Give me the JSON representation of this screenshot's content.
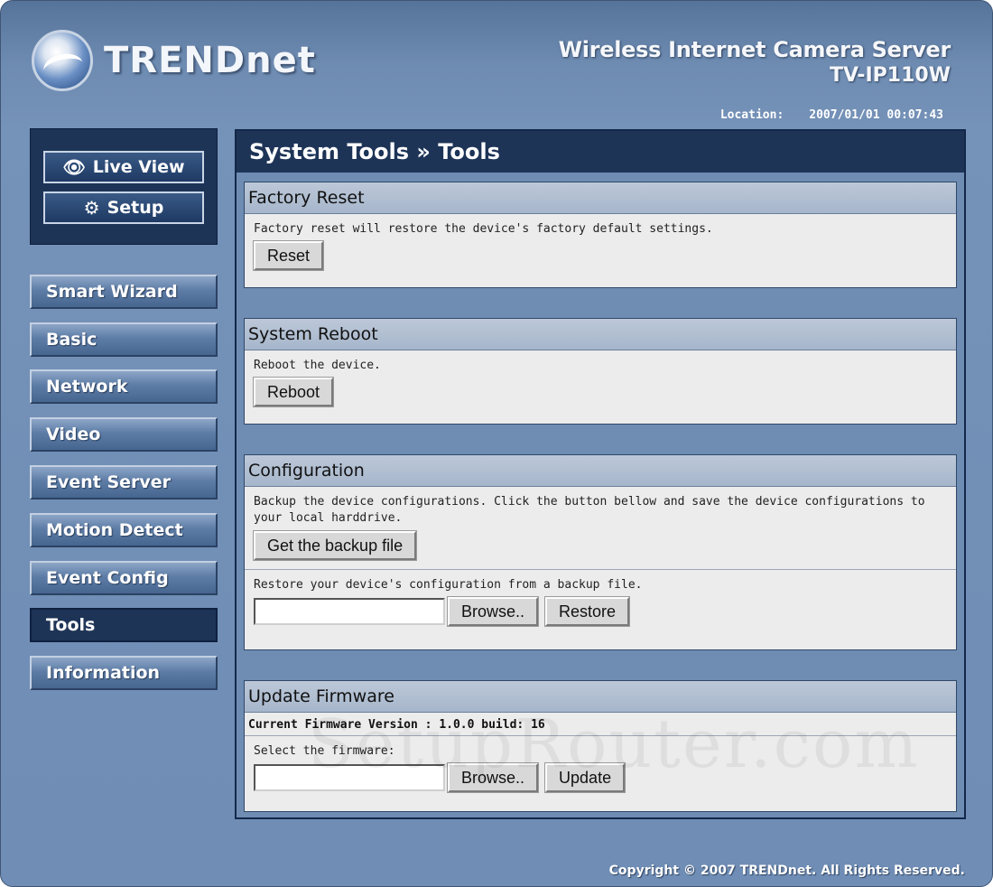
{
  "brand": {
    "name": "TRENDnet"
  },
  "product": {
    "title": "Wireless Internet Camera Server",
    "model": "TV-IP110W"
  },
  "location": {
    "label": "Location:",
    "datetime": "2007/01/01 00:07:43"
  },
  "view_buttons": [
    {
      "label": "Live View",
      "icon": "eye-icon"
    },
    {
      "label": "Setup",
      "icon": "gears-icon"
    }
  ],
  "nav": {
    "items": [
      {
        "label": "Smart Wizard"
      },
      {
        "label": "Basic"
      },
      {
        "label": "Network"
      },
      {
        "label": "Video"
      },
      {
        "label": "Event Server"
      },
      {
        "label": "Motion Detect"
      },
      {
        "label": "Event Config"
      },
      {
        "label": "Tools",
        "active": true
      },
      {
        "label": "Information"
      }
    ]
  },
  "page": {
    "title": "System Tools » Tools",
    "factory_reset": {
      "heading": "Factory Reset",
      "description": "Factory reset will restore the device's factory default settings.",
      "button": "Reset"
    },
    "system_reboot": {
      "heading": "System Reboot",
      "description": "Reboot the device.",
      "button": "Reboot"
    },
    "configuration": {
      "heading": "Configuration",
      "backup_description": "Backup the device configurations. Click the button bellow and save the device configurations to your local harddrive.",
      "backup_button": "Get the backup file",
      "restore_description": "Restore your device's configuration from a backup file.",
      "browse_button": "Browse..",
      "restore_button": "Restore",
      "restore_file_value": ""
    },
    "update_firmware": {
      "heading": "Update Firmware",
      "current_version": "Current Firmware Version : 1.0.0 build: 16",
      "select_label": "Select the firmware:",
      "browse_button": "Browse..",
      "update_button": "Update",
      "firmware_file_value": ""
    }
  },
  "watermark": "SetupRouter.com",
  "footer": {
    "copyright": "Copyright © 2007 TRENDnet. All Rights Reserved."
  }
}
